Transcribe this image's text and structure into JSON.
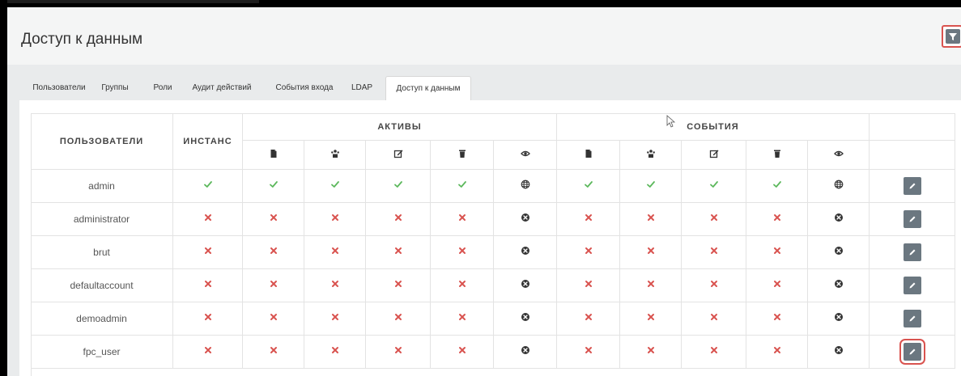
{
  "page": {
    "title": "Доступ к данным"
  },
  "tabs": [
    {
      "label": "Пользователи"
    },
    {
      "label": "Группы"
    },
    {
      "label": "Роли"
    },
    {
      "label": "Аудит действий"
    },
    {
      "label": "События входа"
    },
    {
      "label": "LDAP"
    },
    {
      "label": "Доступ к данным"
    }
  ],
  "table": {
    "headers": {
      "users": "ПОЛЬЗОВАТЕЛИ",
      "instance": "ИНСТАНС",
      "assets": "АКТИВЫ",
      "events": "СОБЫТИЯ"
    },
    "sub_icons": [
      "file-icon",
      "users-icon",
      "edit-icon",
      "trash-icon",
      "eye-icon"
    ],
    "rows": [
      {
        "user": "admin",
        "instance": "check",
        "assets": [
          "check",
          "check",
          "check",
          "check",
          "globe"
        ],
        "events": [
          "check",
          "check",
          "check",
          "check",
          "globe"
        ]
      },
      {
        "user": "administrator",
        "instance": "cross",
        "assets": [
          "cross",
          "cross",
          "cross",
          "cross",
          "xcircle"
        ],
        "events": [
          "cross",
          "cross",
          "cross",
          "cross",
          "xcircle"
        ]
      },
      {
        "user": "brut",
        "instance": "cross",
        "assets": [
          "cross",
          "cross",
          "cross",
          "cross",
          "xcircle"
        ],
        "events": [
          "cross",
          "cross",
          "cross",
          "cross",
          "xcircle"
        ]
      },
      {
        "user": "defaultaccount",
        "instance": "cross",
        "assets": [
          "cross",
          "cross",
          "cross",
          "cross",
          "xcircle"
        ],
        "events": [
          "cross",
          "cross",
          "cross",
          "cross",
          "xcircle"
        ]
      },
      {
        "user": "demoadmin",
        "instance": "cross",
        "assets": [
          "cross",
          "cross",
          "cross",
          "cross",
          "xcircle"
        ],
        "events": [
          "cross",
          "cross",
          "cross",
          "cross",
          "xcircle"
        ]
      },
      {
        "user": "fpc_user",
        "instance": "cross",
        "assets": [
          "cross",
          "cross",
          "cross",
          "cross",
          "xcircle"
        ],
        "events": [
          "cross",
          "cross",
          "cross",
          "cross",
          "xcircle"
        ]
      }
    ]
  },
  "colors": {
    "check": "#5cb85c",
    "cross": "#d9534f",
    "dark_icon": "#333333",
    "button": "#6b7780",
    "highlight": "#d9534f"
  },
  "icons": {
    "filter": "filter-icon",
    "edit_button": "pencil-icon"
  }
}
